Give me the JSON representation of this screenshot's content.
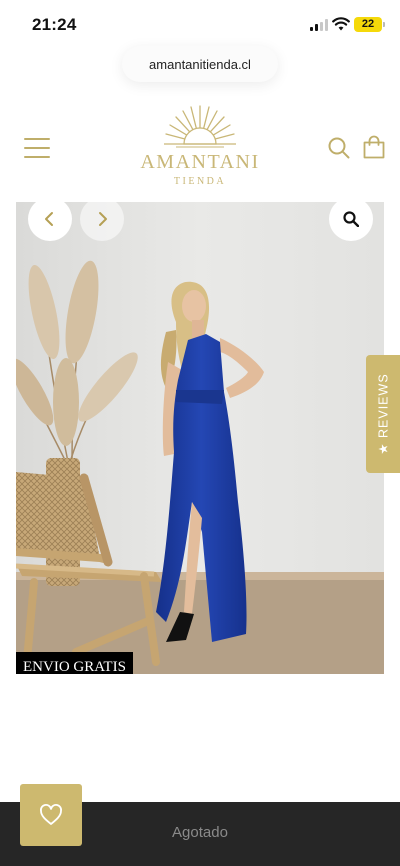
{
  "status_bar": {
    "time": "21:24",
    "battery": "22"
  },
  "browser": {
    "url": "amantanitienda.cl"
  },
  "header": {
    "logo_name": "AMANTANI",
    "logo_sub": "TIENDA",
    "icons": {
      "menu": "hamburger-menu-icon",
      "search": "search-icon",
      "bag": "shopping-bag-icon"
    }
  },
  "gallery": {
    "badge": "ENVIO GRATIS",
    "icons": {
      "prev": "chevron-left-icon",
      "next": "chevron-right-icon",
      "zoom": "magnifier-icon"
    }
  },
  "reviews_tab": {
    "label": "★ REVIEWS"
  },
  "footer": {
    "button_label": "Agotado",
    "wishlist_icon": "heart-icon"
  },
  "colors": {
    "gold": "#cdb96f",
    "dress_blue": "#1f3fa3",
    "bottom_bar": "#262626"
  }
}
